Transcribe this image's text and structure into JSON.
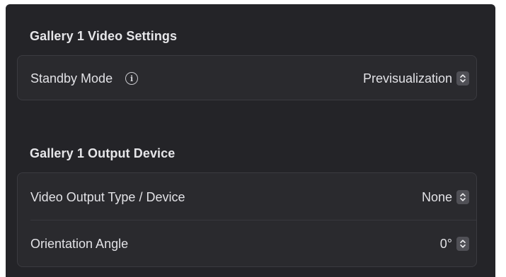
{
  "video_settings": {
    "title": "Gallery 1 Video Settings",
    "standby_mode": {
      "label": "Standby Mode",
      "value": "Previsualization",
      "info_icon": "info-circle-icon"
    }
  },
  "output_device": {
    "title": "Gallery 1 Output Device",
    "video_output_type": {
      "label": "Video Output Type / Device",
      "value": "None"
    },
    "orientation_angle": {
      "label": "Orientation Angle",
      "value": "0°"
    }
  },
  "icons": {
    "stepper": "chevron-up-down-icon"
  },
  "colors": {
    "background": "#242428",
    "group_background": "#2a2a2e",
    "group_border": "#3b3b40",
    "text": "#e2e2e6",
    "stepper_background": "#505056"
  }
}
